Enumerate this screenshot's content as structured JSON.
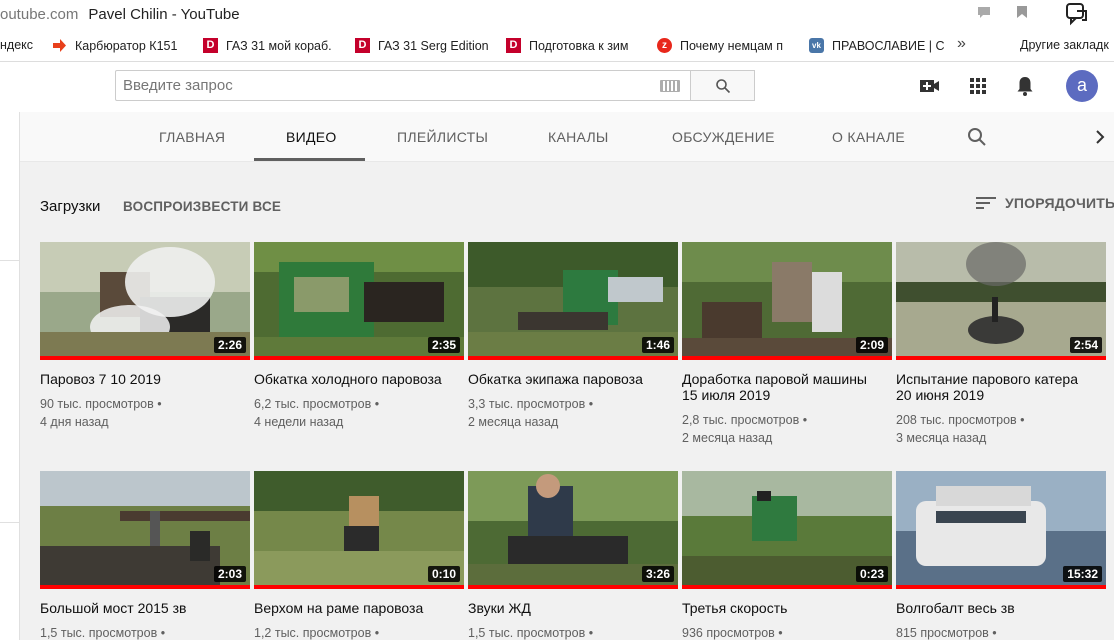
{
  "browser": {
    "url_fragment": "outube.com",
    "page_title": "Pavel Chilin - YouTube"
  },
  "bookmarks": [
    {
      "label": "ндекс",
      "icon": "none-icon"
    },
    {
      "label": "Карбюратор К151",
      "icon": "arrow-icon"
    },
    {
      "label": "ГАЗ 31 мой кораб.",
      "icon": "drive2-icon"
    },
    {
      "label": "ГАЗ 31 Serg Edition",
      "icon": "drive2-icon"
    },
    {
      "label": "Подготовка к зим",
      "icon": "drive2-icon"
    },
    {
      "label": "Почему немцам п",
      "icon": "zen-icon"
    },
    {
      "label": "ПРАВОСЛАВИЕ | С",
      "icon": "vk-icon"
    }
  ],
  "bookmarks_more": "»",
  "bookmarks_other": "Другие закладк",
  "header": {
    "search_placeholder": "Введите запрос",
    "avatar_letter": "a"
  },
  "tabs": [
    {
      "label": "ГЛАВНАЯ",
      "active": false
    },
    {
      "label": "ВИДЕО",
      "active": true
    },
    {
      "label": "ПЛЕЙЛИСТЫ",
      "active": false
    },
    {
      "label": "КАНАЛЫ",
      "active": false
    },
    {
      "label": "ОБСУЖДЕНИЕ",
      "active": false
    },
    {
      "label": "О КАНАЛЕ",
      "active": false
    }
  ],
  "section": {
    "title": "Загрузки",
    "play_all": "ВОСПРОИЗВЕСТИ ВСЕ",
    "sort_label": "УПОРЯДОЧИТЬ"
  },
  "videos": [
    {
      "title": "Паровоз 7 10 2019",
      "duration": "2:26",
      "views": "90 тыс. просмотров •",
      "age": "4 дня назад"
    },
    {
      "title": "Обкатка холодного паровоза",
      "duration": "2:35",
      "views": "6,2 тыс. просмотров •",
      "age": "4 недели назад"
    },
    {
      "title": "Обкатка экипажа паровоза",
      "duration": "1:46",
      "views": "3,3 тыс. просмотров •",
      "age": "2 месяца назад"
    },
    {
      "title": "Доработка паровой машины 15 июля 2019",
      "duration": "2:09",
      "views": "2,8 тыс. просмотров •",
      "age": "2 месяца назад"
    },
    {
      "title": "Испытание парового катера 20 июня 2019",
      "duration": "2:54",
      "views": "208 тыс. просмотров •",
      "age": "3 месяца назад"
    },
    {
      "title": "Большой мост 2015 зв",
      "duration": "2:03",
      "views": "1,5 тыс. просмотров •",
      "age": ""
    },
    {
      "title": "Верхом на раме паровоза",
      "duration": "0:10",
      "views": "1,2 тыс. просмотров •",
      "age": ""
    },
    {
      "title": "Звуки ЖД",
      "duration": "3:26",
      "views": "1,5 тыс. просмотров •",
      "age": ""
    },
    {
      "title": "Третья скорость",
      "duration": "0:23",
      "views": "936 просмотров •",
      "age": ""
    },
    {
      "title": "Волгобалт весь зв",
      "duration": "15:32",
      "views": "815 просмотров •",
      "age": ""
    }
  ],
  "colors": {
    "progress_red": "#ff0000",
    "avatar_bg": "#5c6bc0"
  }
}
